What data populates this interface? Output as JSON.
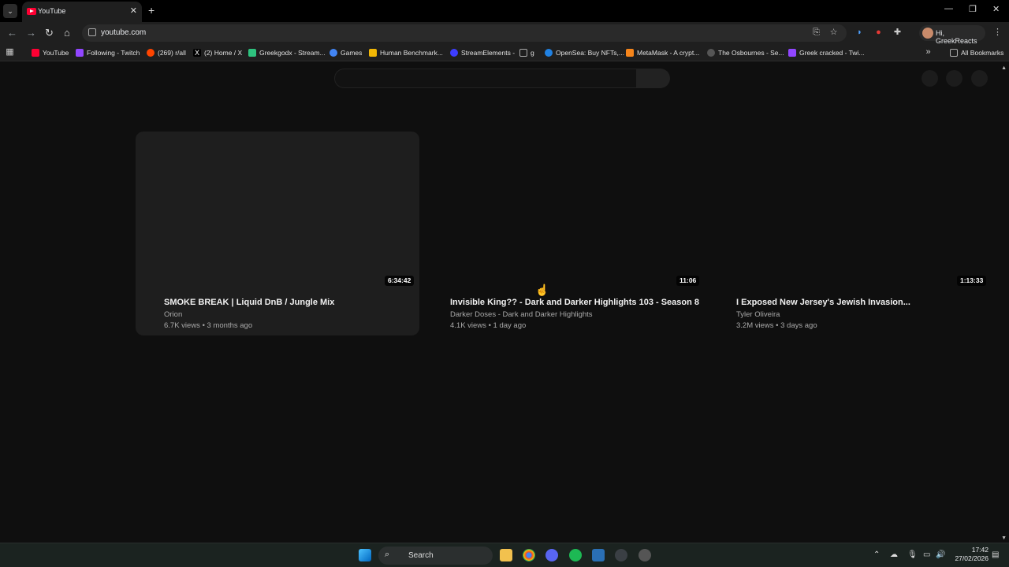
{
  "browser": {
    "tab": {
      "title": "YouTube"
    },
    "url": "youtube.com",
    "profile_label": "Hi, GreekReacts"
  },
  "bookmarks": [
    {
      "label": "YouTube",
      "color": "#ff0033"
    },
    {
      "label": "Following - Twitch",
      "color": "#9146ff"
    },
    {
      "label": "(269) r/all",
      "color": "#ff4500"
    },
    {
      "label": "(2) Home / X",
      "color": "#ffffff"
    },
    {
      "label": "Greekgodx - Stream...",
      "color": "#2ec27e"
    },
    {
      "label": "Games",
      "color": "#4285f4"
    },
    {
      "label": "Human Benchmark...",
      "color": "#f2b705"
    },
    {
      "label": "StreamElements -",
      "color": "#3d3dff"
    },
    {
      "label": "g",
      "color": "#aaaaaa"
    },
    {
      "label": "OpenSea: Buy NFTs,...",
      "color": "#2081e2"
    },
    {
      "label": "MetaMask - A crypt...",
      "color": "#f6851b"
    },
    {
      "label": "The Osbournes - Se...",
      "color": "#555555"
    },
    {
      "label": "Greek cracked - Twi...",
      "color": "#9146ff"
    }
  ],
  "all_bookmarks_label": "All Bookmarks",
  "videos": [
    {
      "duration": "6:34:42",
      "title": "SMOKE BREAK | Liquid DnB / Jungle Mix",
      "channel": "Orion",
      "meta": "6.7K views • 3 months ago"
    },
    {
      "duration": "11:06",
      "title": "Invisible King?? - Dark and Darker Highlights 103 - Season 8",
      "channel": "Darker Doses - Dark and Darker Highlights",
      "meta": "4.1K views • 1 day ago"
    },
    {
      "duration": "1:13:33",
      "title": "I Exposed New Jersey's Jewish Invasion...",
      "channel": "Tyler Oliveira",
      "meta": "3.2M views • 3 days ago"
    }
  ],
  "taskbar": {
    "search_label": "Search",
    "time": "17:42",
    "date": "27/02/2026"
  },
  "colors": {
    "page_bg": "#0f0f0f",
    "chrome_bg": "#1f1f1f",
    "accent_red": "#ff0033"
  }
}
